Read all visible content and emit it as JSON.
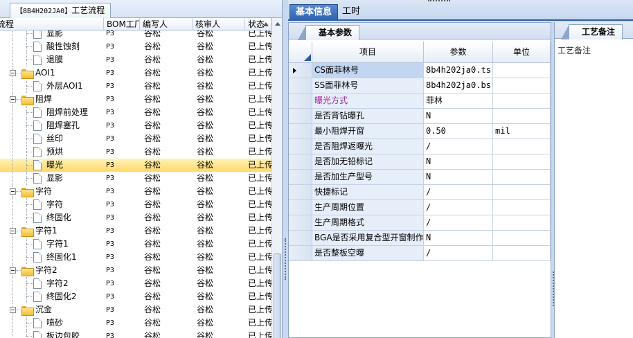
{
  "left_tab": {
    "code": "【8B4H202JA0】",
    "title": "工艺流程"
  },
  "tree_headers": [
    "流程",
    "BOM工厂",
    "编写人",
    "核审人",
    "状态"
  ],
  "tree_rows": [
    {
      "name": "显影",
      "level": 2,
      "bom": "P3",
      "writer": "谷松",
      "reviewer": "谷松",
      "status": "已上传"
    },
    {
      "name": "酸性蚀刻",
      "level": 2,
      "bom": "P3",
      "writer": "谷松",
      "reviewer": "谷松",
      "status": "已上传"
    },
    {
      "name": "退膜",
      "level": 2,
      "bom": "P3",
      "writer": "谷松",
      "reviewer": "谷松",
      "status": "已上传"
    },
    {
      "name": "AOI1",
      "level": 1,
      "bom": "P3",
      "writer": "谷松",
      "reviewer": "谷松",
      "status": "已上传"
    },
    {
      "name": "外层AOI1",
      "level": 2,
      "bom": "P3",
      "writer": "谷松",
      "reviewer": "谷松",
      "status": "已上传"
    },
    {
      "name": "阻焊",
      "level": 1,
      "bom": "P3",
      "writer": "谷松",
      "reviewer": "谷松",
      "status": "已上传"
    },
    {
      "name": "阻焊前处理",
      "level": 2,
      "bom": "P3",
      "writer": "谷松",
      "reviewer": "谷松",
      "status": "已上传"
    },
    {
      "name": "阻焊塞孔",
      "level": 2,
      "bom": "P3",
      "writer": "谷松",
      "reviewer": "谷松",
      "status": "已上传"
    },
    {
      "name": "丝印",
      "level": 2,
      "bom": "P3",
      "writer": "谷松",
      "reviewer": "谷松",
      "status": "已上传"
    },
    {
      "name": "预烘",
      "level": 2,
      "bom": "P3",
      "writer": "谷松",
      "reviewer": "谷松",
      "status": "已上传"
    },
    {
      "name": "曝光",
      "level": 2,
      "bom": "P3",
      "writer": "谷松",
      "reviewer": "谷松",
      "status": "已上传",
      "selected": true
    },
    {
      "name": "显影",
      "level": 2,
      "bom": "P3",
      "writer": "谷松",
      "reviewer": "谷松",
      "status": "已上传"
    },
    {
      "name": "字符",
      "level": 1,
      "bom": "P3",
      "writer": "谷松",
      "reviewer": "谷松",
      "status": "已上传"
    },
    {
      "name": "字符",
      "level": 2,
      "bom": "P3",
      "writer": "谷松",
      "reviewer": "谷松",
      "status": "已上传"
    },
    {
      "name": "终固化",
      "level": 2,
      "bom": "P3",
      "writer": "谷松",
      "reviewer": "谷松",
      "status": "已上传"
    },
    {
      "name": "字符1",
      "level": 1,
      "bom": "P3",
      "writer": "谷松",
      "reviewer": "谷松",
      "status": "已上传"
    },
    {
      "name": "字符1",
      "level": 2,
      "bom": "P3",
      "writer": "谷松",
      "reviewer": "谷松",
      "status": "已上传"
    },
    {
      "name": "终固化1",
      "level": 2,
      "bom": "P3",
      "writer": "谷松",
      "reviewer": "谷松",
      "status": "已上传"
    },
    {
      "name": "字符2",
      "level": 1,
      "bom": "P3",
      "writer": "谷松",
      "reviewer": "谷松",
      "status": "已上传"
    },
    {
      "name": "字符2",
      "level": 2,
      "bom": "P3",
      "writer": "谷松",
      "reviewer": "谷松",
      "status": "已上传"
    },
    {
      "name": "终固化2",
      "level": 2,
      "bom": "P3",
      "writer": "谷松",
      "reviewer": "谷松",
      "status": "已上传"
    },
    {
      "name": "沉金",
      "level": 1,
      "bom": "P3",
      "writer": "谷松",
      "reviewer": "谷松",
      "status": "已上传"
    },
    {
      "name": "喷砂",
      "level": 2,
      "bom": "P3",
      "writer": "谷松",
      "reviewer": "谷松",
      "status": "已上传"
    },
    {
      "name": "板边包胶",
      "level": 2,
      "bom": "P3",
      "writer": "谷松",
      "reviewer": "谷松",
      "status": "已上传"
    }
  ],
  "main_tabs": [
    {
      "label": "基本信息",
      "active": true
    },
    {
      "label": "工时",
      "active": false
    }
  ],
  "params_tab": "基本参数",
  "notes_tab": "工艺备注",
  "notes_label": "工艺备注",
  "grid_headers": {
    "item": "项目",
    "param": "参数",
    "unit": "单位"
  },
  "params": [
    {
      "name": "CS面菲林号",
      "value": "8b4h202ja0.ts",
      "unit": "",
      "current": true
    },
    {
      "name": "SS面菲林号",
      "value": "8b4h202ja0.bs",
      "unit": ""
    },
    {
      "name": "曝光方式",
      "value": "菲林",
      "unit": "",
      "highlight": true
    },
    {
      "name": "是否背钻曝孔",
      "value": "N",
      "unit": ""
    },
    {
      "name": "最小阻焊开窗",
      "value": "0.50",
      "unit": "mil"
    },
    {
      "name": "是否阻焊返曝光",
      "value": "/",
      "unit": ""
    },
    {
      "name": "是否加无铅标记",
      "value": "N",
      "unit": ""
    },
    {
      "name": "是否加生产型号",
      "value": "N",
      "unit": ""
    },
    {
      "name": "快捷标记",
      "value": "/",
      "unit": ""
    },
    {
      "name": "生产周期位置",
      "value": "/",
      "unit": ""
    },
    {
      "name": "生产周期格式",
      "value": "/",
      "unit": ""
    },
    {
      "name": "BGA是否采用复合型开窗制作",
      "value": "N",
      "unit": ""
    },
    {
      "name": "是否整板空曝",
      "value": "/",
      "unit": ""
    }
  ],
  "colors": {
    "highlight_text": "#a0209a",
    "selected_row": "#ffd96a",
    "tab_active": "#2e61aa"
  }
}
